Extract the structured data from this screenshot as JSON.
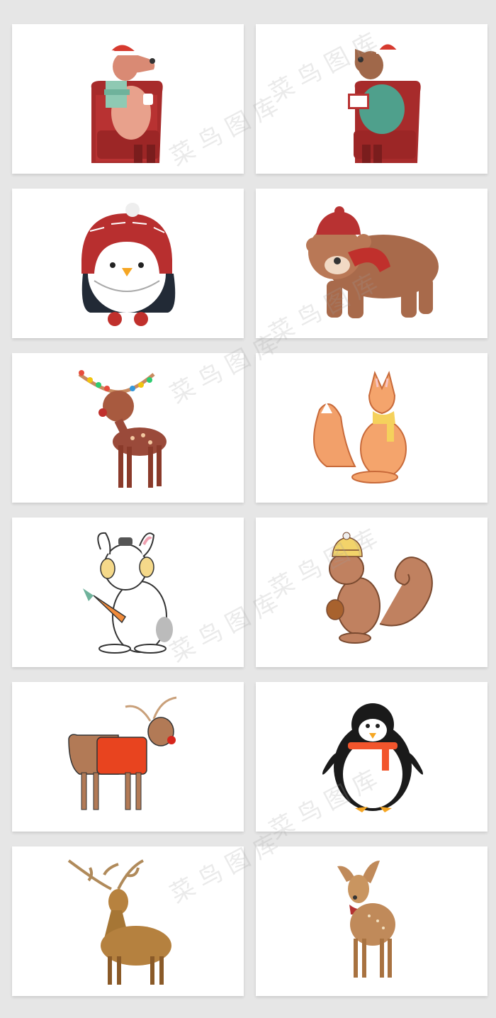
{
  "watermark": {
    "text": "菜鸟图库"
  },
  "cards": [
    {
      "id": "bear-armchair-mug",
      "icon": "bear-in-armchair-drinking-icon"
    },
    {
      "id": "bear-armchair-book",
      "icon": "bear-in-armchair-reading-icon"
    },
    {
      "id": "penguin-red-hat",
      "icon": "penguin-in-knit-hat-icon"
    },
    {
      "id": "brown-bear-scarf",
      "icon": "brown-bear-with-scarf-icon"
    },
    {
      "id": "reindeer-lights",
      "icon": "fawn-with-christmas-lights-icon"
    },
    {
      "id": "fox-scarf",
      "icon": "fox-with-scarf-icon"
    },
    {
      "id": "rabbit-earmuffs",
      "icon": "rabbit-with-carrot-icon"
    },
    {
      "id": "squirrel-hat",
      "icon": "squirrel-with-acorn-icon"
    },
    {
      "id": "reindeer-sweater",
      "icon": "reindeer-in-red-sweater-icon"
    },
    {
      "id": "penguin-scarf",
      "icon": "penguin-with-orange-scarf-icon"
    },
    {
      "id": "stag-watercolor",
      "icon": "watercolor-stag-icon"
    },
    {
      "id": "fawn-watercolor",
      "icon": "watercolor-fawn-with-scarf-icon"
    }
  ]
}
